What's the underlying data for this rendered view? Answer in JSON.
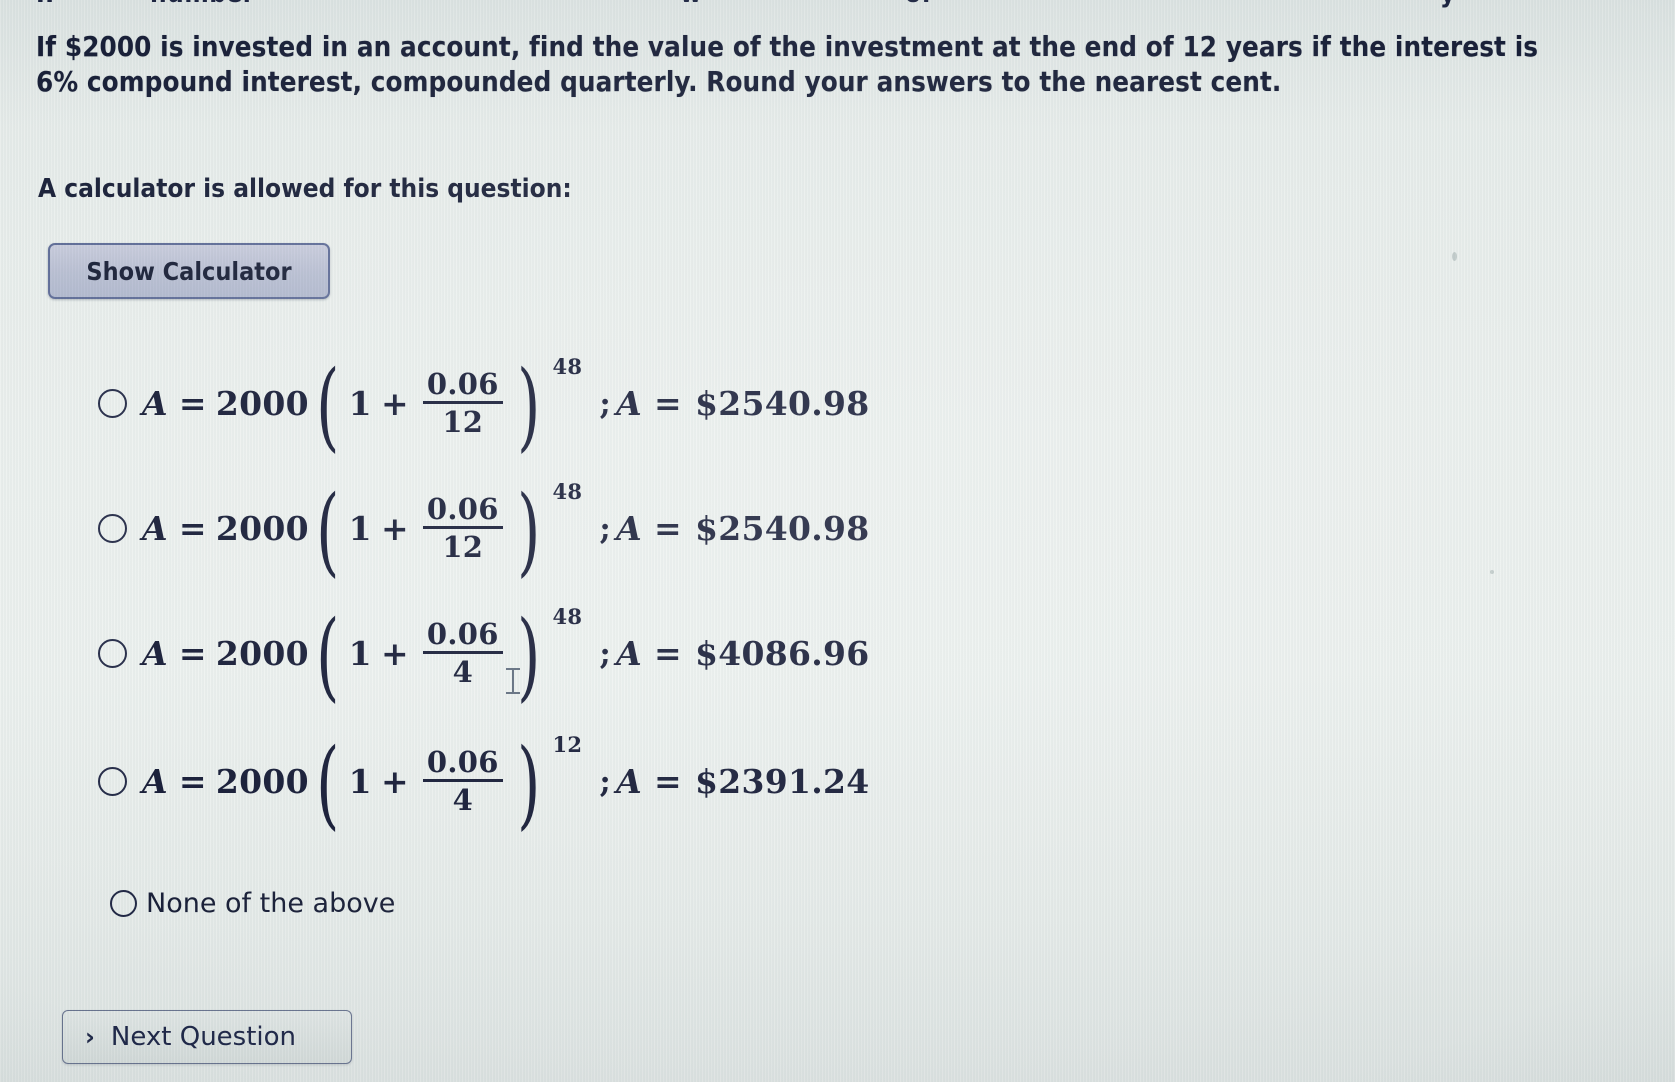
{
  "top_cut_row": {
    "fragments": [
      "IF",
      "number",
      "w",
      "of",
      "y"
    ]
  },
  "question": {
    "line1_pre": "If ",
    "amount": "$2000",
    "line1_mid": " is invested in an account, find the value of the investment at the end of ",
    "years": "12",
    "line1_post": " years if the interest is",
    "line2_rate": "6%",
    "line2_post": " compound interest, compounded quarterly. Round your answers to the nearest cent."
  },
  "calculator_note": "A calculator is allowed for this question:",
  "show_calculator_button": "Show Calculator",
  "options": [
    {
      "id": "option-1",
      "lhs_A": "A",
      "equals": "=",
      "principal": "2000",
      "one": "1",
      "plus": "+",
      "fraction_num": "0.06",
      "fraction_den": "12",
      "exponent": "48",
      "separator": ";",
      "result_A": "A",
      "result_equals": "=",
      "result_value": "$2540.98",
      "selected": false
    },
    {
      "id": "option-2",
      "lhs_A": "A",
      "equals": "=",
      "principal": "2000",
      "one": "1",
      "plus": "+",
      "fraction_num": "0.06",
      "fraction_den": "12",
      "exponent": "48",
      "separator": ";",
      "result_A": "A",
      "result_equals": "=",
      "result_value": "$2540.98",
      "selected": false
    },
    {
      "id": "option-3",
      "lhs_A": "A",
      "equals": "=",
      "principal": "2000",
      "one": "1",
      "plus": "+",
      "fraction_num": "0.06",
      "fraction_den": "4",
      "exponent": "48",
      "separator": ";",
      "result_A": "A",
      "result_equals": "=",
      "result_value": "$4086.96",
      "selected": false
    },
    {
      "id": "option-4",
      "lhs_A": "A",
      "equals": "=",
      "principal": "2000",
      "one": "1",
      "plus": "+",
      "fraction_num": "0.06",
      "fraction_den": "4",
      "exponent": "12",
      "separator": ";",
      "result_A": "A",
      "result_equals": "=",
      "result_value": "$2391.24",
      "selected": false
    }
  ],
  "none_of_the_above": "None of the above",
  "next_question": {
    "chevron": "›",
    "label": "Next Question"
  },
  "colors": {
    "text": "#141b33",
    "background": "#eaefed",
    "button_face": "#bcc2d6",
    "button_border": "#5c6a96"
  }
}
